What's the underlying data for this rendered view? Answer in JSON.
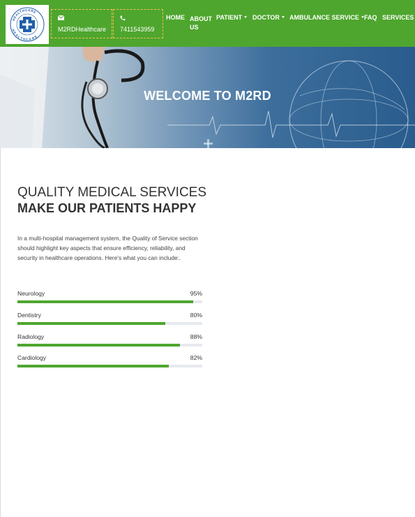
{
  "header": {
    "logo": {
      "text_top": "HEALTHCARE",
      "text_bottom": "HEALTHCARE"
    },
    "email": {
      "icon": "envelope-icon",
      "label": "M2RDHealthcare"
    },
    "phone": {
      "icon": "phone-icon",
      "label": "7411543959"
    },
    "nav": [
      {
        "label": "HOME",
        "dropdown": false
      },
      {
        "label": "ABOUT",
        "label2": "US",
        "dropdown": false
      },
      {
        "label": "PATIENT",
        "dropdown": true
      },
      {
        "label": "DOCTOR",
        "dropdown": true
      },
      {
        "label": "AMBULANCE SERVICE",
        "dropdown": true
      },
      {
        "label": "FAQ",
        "dropdown": false
      },
      {
        "label": "SERVICES",
        "dropdown": false
      }
    ]
  },
  "hero": {
    "title": "WELCOME TO M2RD"
  },
  "quality": {
    "heading": "QUALITY MEDICAL SERVICES",
    "subheading": "MAKE OUR PATIENTS HAPPY",
    "description": "In a multi-hospital management system, the Quality of Service section should highlight key aspects that ensure efficiency, reliability, and security in healthcare operations. Here's what you can include:.",
    "skills": [
      {
        "name": "Neurology",
        "percent_label": "95%",
        "value": 95
      },
      {
        "name": "Dentistry",
        "percent_label": "80%",
        "value": 80
      },
      {
        "name": "Radiology",
        "percent_label": "88%",
        "value": 88
      },
      {
        "name": "Cardiology",
        "percent_label": "82%",
        "value": 82
      }
    ]
  },
  "colors": {
    "primary_green": "#4ea62e",
    "accent_dashed": "#f2c14e",
    "logo_blue": "#1f5fa8"
  }
}
